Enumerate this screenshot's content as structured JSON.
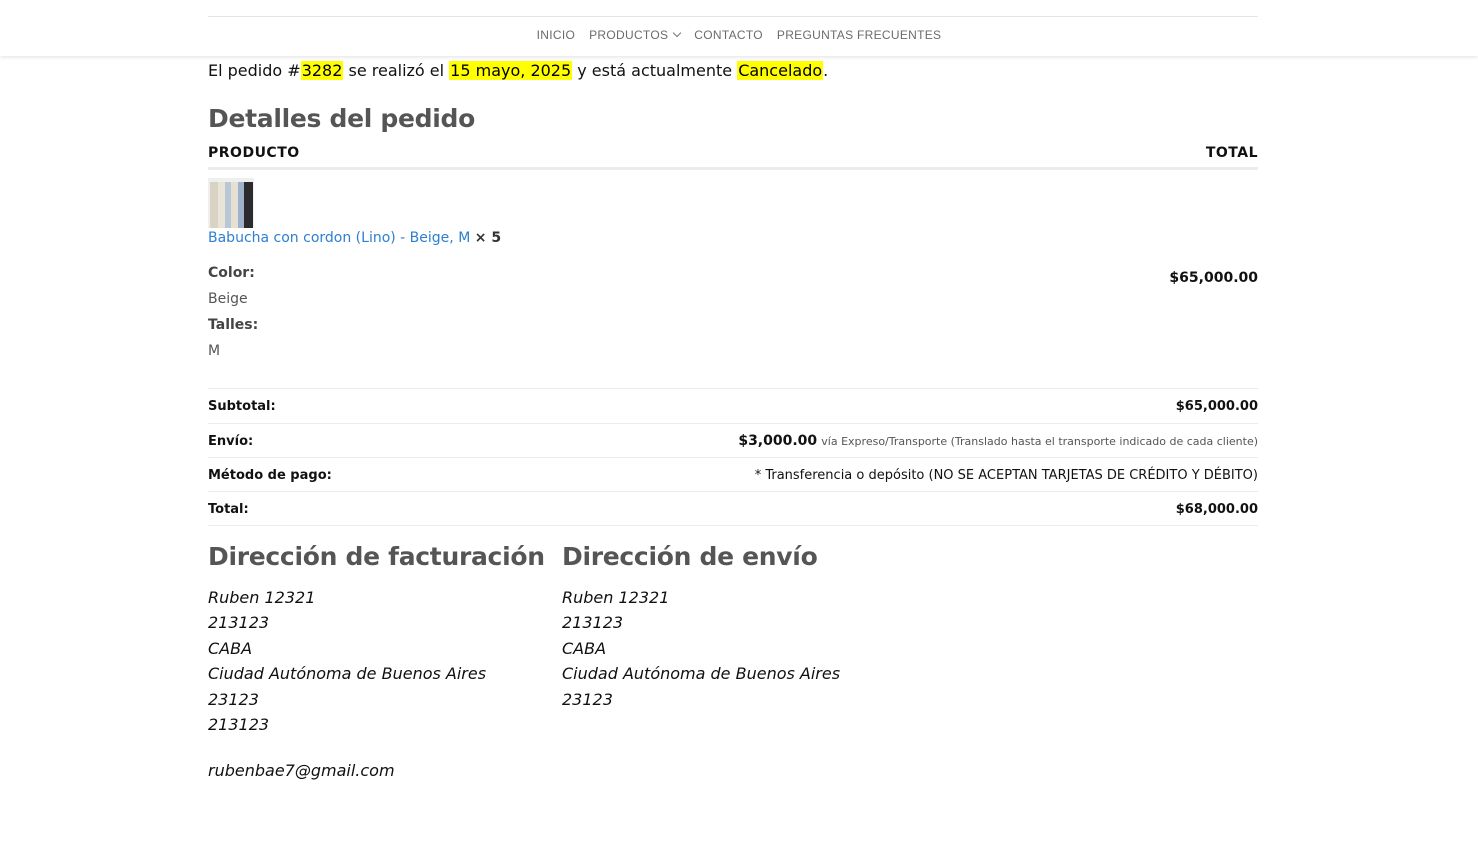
{
  "nav": {
    "items": [
      {
        "label": "INICIO"
      },
      {
        "label": "PRODUCTOS",
        "has_dropdown": true
      },
      {
        "label": "CONTACTO"
      },
      {
        "label": "PREGUNTAS FRECUENTES"
      }
    ]
  },
  "status": {
    "prefix": "El pedido #",
    "order_number": "3282",
    "mid": " se realizó el ",
    "date": "15 mayo, 2025",
    "mid2": " y está actualmente ",
    "state": "Cancelado",
    "suffix": "."
  },
  "order": {
    "title": "Detalles del pedido",
    "headers": {
      "product": "PRODUCTO",
      "total": "TOTAL"
    },
    "item": {
      "name": "Babucha con cordon (Lino) - Beige, M",
      "qty": "× 5",
      "meta": [
        {
          "key": "Color:",
          "value": "Beige"
        },
        {
          "key": "Talles:",
          "value": "M"
        }
      ],
      "total": "$65,000.00"
    },
    "totals": {
      "subtotal_label": "Subtotal:",
      "subtotal_value": "$65,000.00",
      "shipping_label": "Envío:",
      "shipping_amount": "$3,000.00",
      "shipping_via": "vía Expreso/Transporte (Translado hasta el transporte indicado de cada cliente)",
      "payment_label": "Método de pago:",
      "payment_value": "* Transferencia o depósito (NO SE ACEPTAN TARJETAS DE CRÉDITO Y DÉBITO)",
      "total_label": "Total:",
      "total_value": "$68,000.00"
    }
  },
  "billing": {
    "title": "Dirección de facturación",
    "lines": [
      "Ruben 12321",
      "213123",
      "CABA",
      "Ciudad Autónoma de Buenos Aires",
      "23123",
      "213123"
    ],
    "email": "rubenbae7@gmail.com"
  },
  "shipping": {
    "title": "Dirección de envío",
    "lines": [
      "Ruben 12321",
      "213123",
      "CABA",
      "Ciudad Autónoma de Buenos Aires",
      "23123"
    ]
  },
  "colors": {
    "highlight": "#ffff00",
    "link": "#2d7fd0",
    "heading": "#555555"
  }
}
